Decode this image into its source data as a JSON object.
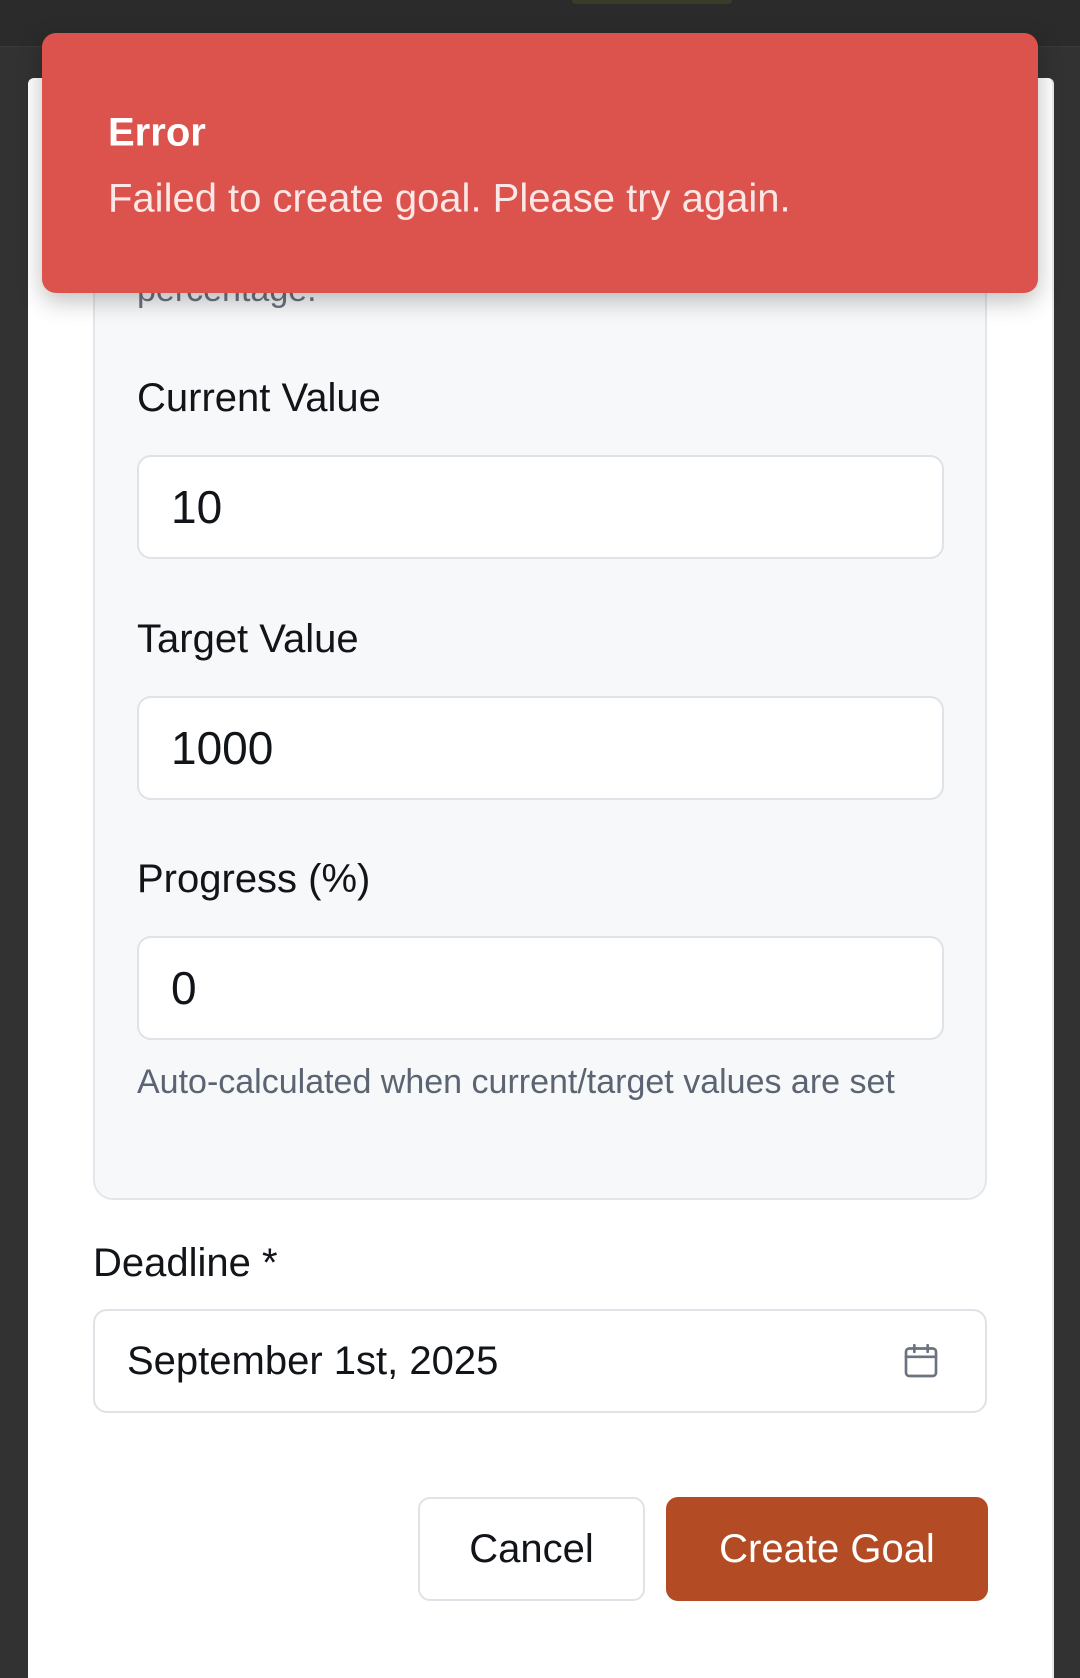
{
  "colors": {
    "toast_background": "#dc524c",
    "primary_button": "#b34b24",
    "card_background": "#f7f8fa",
    "backdrop": "#323232"
  },
  "toast": {
    "title": "Error",
    "message": "Failed to create goal. Please try again."
  },
  "form": {
    "cutoff_text": "percentage.",
    "current_value": {
      "label": "Current Value",
      "value": "10"
    },
    "target_value": {
      "label": "Target Value",
      "value": "1000"
    },
    "progress": {
      "label": "Progress (%)",
      "value": "0",
      "helper": "Auto-calculated when current/target values are set"
    },
    "deadline": {
      "label": "Deadline *",
      "value": "September 1st, 2025",
      "icon": "calendar-icon"
    }
  },
  "actions": {
    "cancel_label": "Cancel",
    "create_label": "Create Goal"
  }
}
